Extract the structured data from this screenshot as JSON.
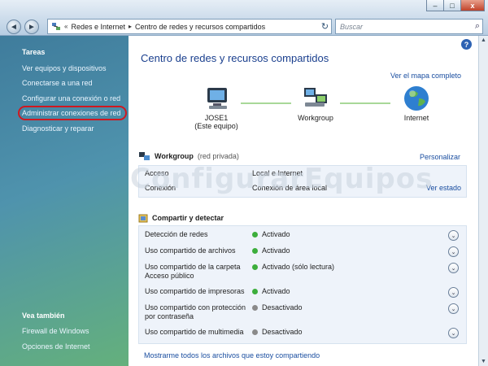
{
  "window": {
    "minimize_glyph": "–",
    "maximize_glyph": "□",
    "close_glyph": "x"
  },
  "address": {
    "back_glyph": "◄",
    "forward_glyph": "►",
    "crumb_prefix": "«",
    "crumb_1": "Redes e Internet",
    "crumb_sep": "▸",
    "crumb_2": "Centro de redes y recursos compartidos",
    "refresh_glyph": "↻",
    "search_placeholder": "Buscar",
    "search_glyph": "⌕"
  },
  "sidebar": {
    "tasks_title": "Tareas",
    "tasks": [
      "Ver equipos y dispositivos",
      "Conectarse a una red",
      "Configurar una conexión o red",
      "Administrar conexiones de red",
      "Diagnosticar y reparar"
    ],
    "see_also_title": "Vea también",
    "see_also": [
      "Firewall de Windows",
      "Opciones de Internet"
    ]
  },
  "main": {
    "help_glyph": "?",
    "title": "Centro de redes y recursos compartidos",
    "map_link": "Ver el mapa completo",
    "map": {
      "computer_name": "JOSE1",
      "computer_sub": "(Este equipo)",
      "network_name": "Workgroup",
      "internet_name": "Internet"
    },
    "network": {
      "name": "Workgroup",
      "type": "(red privada)",
      "customize": "Personalizar",
      "rows": [
        {
          "label": "Acceso",
          "value": "Local e Internet"
        },
        {
          "label": "Conexión",
          "value": "Conexión de área local",
          "action": "Ver estado"
        }
      ]
    },
    "sharing": {
      "title": "Compartir y detectar",
      "rows": [
        {
          "label": "Detección de redes",
          "status": "Activado",
          "state": "on"
        },
        {
          "label": "Uso compartido de archivos",
          "status": "Activado",
          "state": "on"
        },
        {
          "label": "Uso compartido de la carpeta Acceso público",
          "status": "Activado (sólo lectura)",
          "state": "on"
        },
        {
          "label": "Uso compartido de impresoras",
          "status": "Activado",
          "state": "on"
        },
        {
          "label": "Uso compartido con protección por contraseña",
          "status": "Desactivado",
          "state": "off"
        },
        {
          "label": "Uso compartido de multimedia",
          "status": "Desactivado",
          "state": "off"
        }
      ],
      "expand_glyph": "⌄"
    },
    "show_files_link": "Mostrarme todos los archivos que estoy compartiendo",
    "watermark": "ConfigurarEquipos",
    "colors": {
      "on": "#3cae3c",
      "off": "#8a8a8a",
      "link": "#1a4ea0",
      "highlight": "#d01820"
    }
  }
}
